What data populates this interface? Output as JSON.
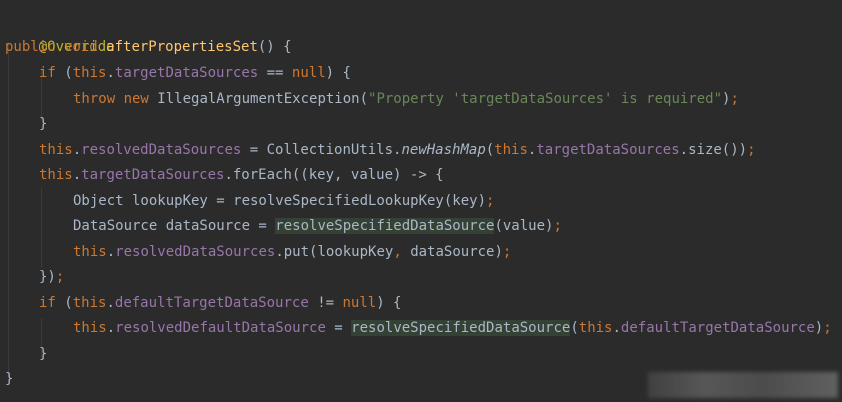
{
  "code": {
    "l1": {
      "ann": "@Override"
    },
    "l2": {
      "kw": "public void ",
      "fn": "afterPropertiesSet",
      "rest": "() {"
    },
    "l3": {
      "kw_if": "if ",
      "p1": "(",
      "this": "this",
      "dot": ".",
      "fld": "targetDataSources",
      "op": " == ",
      "null": "null",
      "end": ") {"
    },
    "l4": {
      "kw": "throw new ",
      "cls": "IllegalArgumentException(",
      "str": "\"Property 'targetDataSources' is required\"",
      "end": ")",
      "semi": ";"
    },
    "l5": {
      "t": "}"
    },
    "l6": {
      "this": "this",
      "dot": ".",
      "fld": "resolvedDataSources",
      "eq": " = CollectionUtils.",
      "static": "newHashMap",
      "p": "(",
      "this2": "this",
      "dot2": ".",
      "fld2": "targetDataSources",
      "end": ".size())",
      "semi": ";"
    },
    "l7": {
      "this": "this",
      "dot": ".",
      "fld": "targetDataSources",
      "end": ".forEach((key, value) -> {"
    },
    "l8": {
      "t": "Object lookupKey = resolveSpecifiedLookupKey(key)",
      "semi": ";"
    },
    "l9": {
      "a": "DataSource dataSource = ",
      "hl": "resolveSpecifiedDataSource",
      "b": "(value)",
      "semi": ";"
    },
    "l10": {
      "this": "this",
      "dot": ".",
      "fld": "resolvedDataSources",
      "a": ".put(lookupKey",
      "comma": ",",
      "b": " dataSource)",
      "semi": ";"
    },
    "l11": {
      "a": "})",
      "semi": ";"
    },
    "l12": {
      "kw": "if ",
      "p": "(",
      "this": "this",
      "dot": ".",
      "fld": "defaultTargetDataSource",
      "op": " != ",
      "null": "null",
      "end": ") {"
    },
    "l13": {
      "this": "this",
      "dot": ".",
      "fld": "resolvedDefaultDataSource",
      "eq": " = ",
      "hl": "resolveSpecifiedDataSource",
      "p": "(",
      "this2": "this",
      "dot2": ".",
      "fld2": "defaultTargetDataSource",
      "end": ")",
      "semi": ";"
    },
    "l14": {
      "t": "}"
    },
    "l15": {
      "t": "}"
    }
  },
  "colors": {
    "background": "#2b2b2b",
    "keyword": "#cc7832",
    "annotation": "#bbb529",
    "method": "#ffc66d",
    "field": "#9876aa",
    "string": "#6a8759",
    "highlight": "#344134"
  }
}
